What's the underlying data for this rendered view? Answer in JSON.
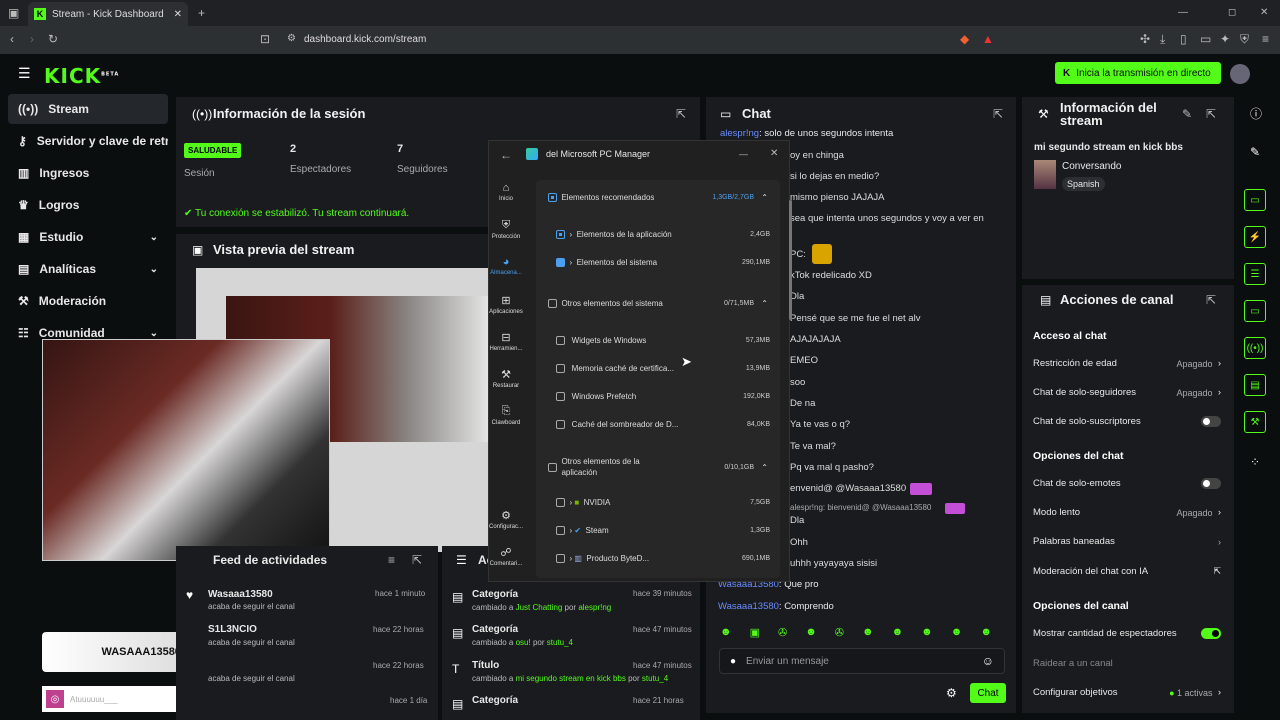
{
  "browser": {
    "tab_title": "Stream - Kick Dashboard",
    "url": "dashboard.kick.com/stream"
  },
  "topbar": {
    "logo": "KICK",
    "beta": "BETA",
    "go_live": "Inicia la transmisión en directo"
  },
  "sidebar": {
    "items": [
      {
        "label": "Stream",
        "active": true,
        "icon": "broadcast-icon"
      },
      {
        "label": "Servidor y clave de retransmisión",
        "icon": "key-icon"
      },
      {
        "label": "Ingresos",
        "icon": "chart-icon"
      },
      {
        "label": "Logros",
        "icon": "trophy-icon"
      },
      {
        "label": "Estudio",
        "icon": "studio-icon",
        "chevron": true
      },
      {
        "label": "Analíticas",
        "icon": "analytics-icon",
        "chevron": true
      },
      {
        "label": "Moderación",
        "icon": "hammer-icon"
      },
      {
        "label": "Comunidad",
        "icon": "community-icon",
        "chevron": true
      }
    ]
  },
  "session": {
    "title": "Información de la sesión",
    "status": "SALUDABLE",
    "session_label": "Sesión",
    "viewers": "2",
    "viewers_label": "Espectadores",
    "followers": "7",
    "followers_label": "Seguidores",
    "notice": "Tu conexión se estabilizó. Tu stream continuará."
  },
  "preview": {
    "title": "Vista previa del stream"
  },
  "overlay": {
    "follower": "WASAAA13580",
    "heart": "♥",
    "input_hint": "Atuuuuuu___"
  },
  "activity": {
    "title": "Feed de actividades",
    "items": [
      {
        "user": "Wasaaa13580",
        "text": "acaba de seguir el canal",
        "time": "hace 1 minuto"
      },
      {
        "user": "S1L3NCIO",
        "text": "acaba de seguir el canal",
        "time": "hace 22 horas"
      },
      {
        "user": "",
        "text": "acaba de seguir el canal",
        "time": "hace 22 horas"
      },
      {
        "user": "",
        "text": "",
        "time": "hace 1 día"
      }
    ]
  },
  "actions": {
    "title": "Acciones",
    "items": [
      {
        "title": "Categoría",
        "pre": "cambiado a",
        "value": "Just Chatting",
        "by_pre": "por",
        "by": "alespr!ng",
        "time": "hace 39 minutos"
      },
      {
        "title": "Categoría",
        "pre": "cambiado a",
        "value": "osu!",
        "by_pre": "por",
        "by": "stutu_4",
        "time": "hace 47 minutos"
      },
      {
        "title": "Título",
        "pre": "cambiado a",
        "value": "mi segundo stream en kick bbs",
        "by_pre": "por",
        "by": "stutu_4",
        "time": "hace 47 minutos"
      },
      {
        "title": "Categoría",
        "pre": "",
        "value": "",
        "by_pre": "",
        "by": "",
        "time": "hace 21 horas"
      }
    ]
  },
  "pc_manager": {
    "title": "del Microsoft PC Manager",
    "side": [
      "Inicio",
      "Protección",
      "Almacena...",
      "Aplicaciones",
      "Herramien...",
      "Restaurar",
      "Clawboard",
      "Configurac...",
      "Comentari..."
    ],
    "rows": [
      {
        "label": "Elementos recomendados",
        "size": "1,3GB/2,7GB",
        "level": 0
      },
      {
        "label": "Elementos de la aplicación",
        "size": "2,4GB",
        "level": 1
      },
      {
        "label": "Elementos del sistema",
        "size": "290,1MB",
        "level": 1
      },
      {
        "label": "Otros elementos del sistema",
        "size": "0/71,5MB",
        "level": 0
      },
      {
        "label": "Widgets de Windows",
        "size": "57,3MB",
        "level": 1
      },
      {
        "label": "Memoria caché de certifica...",
        "size": "13,9MB",
        "level": 1
      },
      {
        "label": "Windows Prefetch",
        "size": "192,0KB",
        "level": 1
      },
      {
        "label": "Caché del sombreador de D...",
        "size": "84,0KB",
        "level": 1
      },
      {
        "label": "Otros elementos de la aplicación",
        "size": "0/10,1GB",
        "level": 0
      },
      {
        "label": "NVIDIA",
        "size": "7,5GB",
        "level": 1
      },
      {
        "label": "Steam",
        "size": "1,3GB",
        "level": 1
      },
      {
        "label": "Producto ByteD...",
        "size": "690,1MB",
        "level": 1
      }
    ]
  },
  "chat": {
    "title": "Chat",
    "lines": [
      {
        "text": "solo de unos segundos intenta",
        "user": "alespr!ng"
      },
      {
        "text": "oy en chinga"
      },
      {
        "text": "si lo dejas en medio?"
      },
      {
        "text": "mismo pienso JAJAJA"
      },
      {
        "text": "sea que intenta unos segundos y voy a ver en"
      },
      {
        "text": "PC:"
      },
      {
        "text": "kTok redelicado XD"
      },
      {
        "text": "Dla"
      },
      {
        "text": "Pensé que se me fue el net alv"
      },
      {
        "text": "AJAJAJAJA"
      },
      {
        "text": "EMEO"
      },
      {
        "text": "soo"
      },
      {
        "text": "De na"
      },
      {
        "text": "Ya te vas o q?"
      },
      {
        "text": "Te va mal?"
      },
      {
        "text": "Pq va mal q pasho?"
      },
      {
        "text": "envenid@ @Wasaaa13580"
      },
      {
        "text": "alespr!ng: bienvenid@ @Wasaaa13580"
      },
      {
        "text": "Dla"
      },
      {
        "text": "Ohh"
      },
      {
        "text": "uhhh yayayaya sisisi"
      }
    ],
    "user_lines": [
      {
        "user": "Wasaaa13580",
        "text": ": Que pro"
      },
      {
        "user": "Wasaaa13580",
        "text": ": Comprendo"
      }
    ],
    "placeholder": "Enviar un mensaje",
    "send": "Chat"
  },
  "stream_info": {
    "title": "Información del stream",
    "stream_title": "mi segundo stream en kick bbs",
    "category": "Conversando",
    "language": "Spanish"
  },
  "channel": {
    "title": "Acciones de canal",
    "chat_access": "Acceso al chat",
    "age": "Restricción de edad",
    "age_val": "Apagado",
    "followers_only": "Chat de solo-seguidores",
    "followers_only_val": "Apagado",
    "subs_only": "Chat de solo-suscriptores",
    "chat_options": "Opciones del chat",
    "emotes_only": "Chat de solo-emotes",
    "slow": "Modo lento",
    "slow_val": "Apagado",
    "banned": "Palabras baneadas",
    "ai_mod": "Moderación del chat con IA",
    "channel_options": "Opciones del canal",
    "show_viewers": "Mostrar cantidad de espectadores",
    "raid": "Raidear a un canal",
    "goals": "Configurar objetivos",
    "goals_val": "1 activas"
  },
  "colors": {
    "accent": "#53fc18",
    "bg": "#0b0e0f",
    "panel": "#191b1f",
    "link": "#6b8cff"
  }
}
